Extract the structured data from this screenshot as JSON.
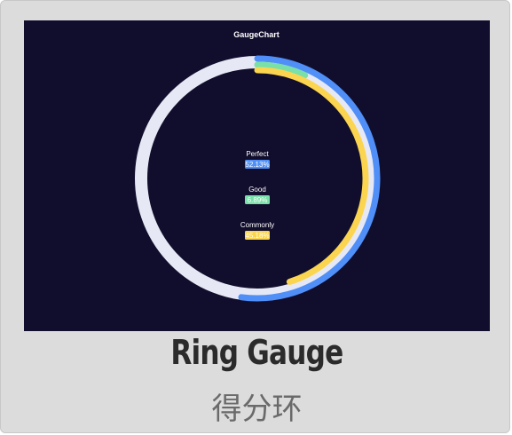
{
  "card": {
    "title": "Ring Gauge",
    "subtitle": "得分环"
  },
  "colors": {
    "panel_bg": "#110d2c",
    "track": "#e6e9f5",
    "title_text": "#ffffff",
    "label_text": "#ffffff"
  },
  "chart_data": {
    "type": "gauge",
    "title": "GaugeChart",
    "max": 100,
    "series": [
      {
        "name": "Perfect",
        "value": 52.13,
        "label": "52.13%",
        "color": "#4f8ff7"
      },
      {
        "name": "Good",
        "value": 6.89,
        "label": "6.89%",
        "color": "#78e0a8"
      },
      {
        "name": "Commonly",
        "value": 45.18,
        "label": "45.18%",
        "color": "#fbd54f"
      }
    ]
  }
}
